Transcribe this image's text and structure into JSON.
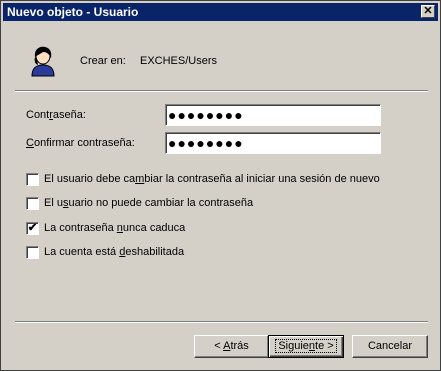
{
  "window": {
    "title": "Nuevo objeto - Usuario",
    "close_glyph": "✕"
  },
  "header": {
    "crear_label": "Crear en:",
    "crear_value": "EXCHES/Users",
    "icon": "user-icon"
  },
  "password": {
    "label_pre": "Cont",
    "label_u": "r",
    "label_post": "aseña:",
    "value": "●●●●●●●●"
  },
  "confirm": {
    "label_pre": "",
    "label_u": "C",
    "label_post": "onfirmar contraseña:",
    "value": "●●●●●●●●"
  },
  "options": [
    {
      "pre": "El usuario debe ca",
      "u": "m",
      "post": "biar la contraseña al iniciar una sesión de nuevo",
      "checked": false
    },
    {
      "pre": "El u",
      "u": "s",
      "post": "uario no puede cambiar la contraseña",
      "checked": false
    },
    {
      "pre": "La contraseña ",
      "u": "n",
      "post": "unca caduca",
      "checked": true
    },
    {
      "pre": "La cuenta está ",
      "u": "d",
      "post": "eshabilitada",
      "checked": false
    }
  ],
  "buttons": {
    "back": {
      "pre": "< ",
      "u": "A",
      "post": "trás"
    },
    "next": {
      "pre": "Siguie",
      "u": "n",
      "post": "te >"
    },
    "cancel": "Cancelar"
  },
  "colors": {
    "titlebar": "#0a246a",
    "face": "#d4d0c8"
  }
}
